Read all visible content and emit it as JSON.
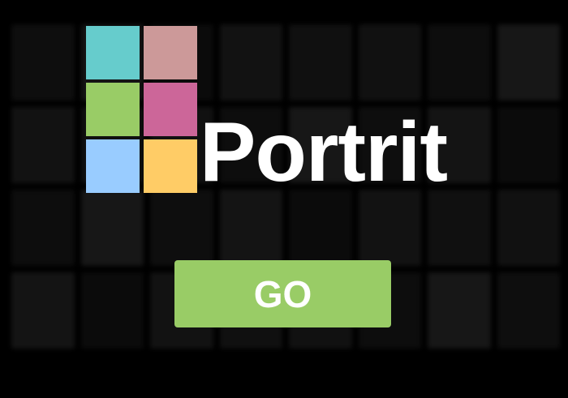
{
  "app": {
    "name": "Portrit"
  },
  "logo": {
    "wordmark": "Portrit",
    "squares": [
      {
        "name": "logo-square-teal",
        "color": "#66cccc"
      },
      {
        "name": "logo-square-rose",
        "color": "#cc9999"
      },
      {
        "name": "logo-square-green",
        "color": "#99cc66"
      },
      {
        "name": "logo-square-magenta",
        "color": "#cc6699"
      },
      {
        "name": "logo-square-lightblue",
        "color": "#99ccff"
      },
      {
        "name": "logo-square-yellow",
        "color": "#ffcc66"
      }
    ]
  },
  "go_button": {
    "label": "GO",
    "color": "#99cc66"
  },
  "background": {
    "color": "#000000",
    "tile_colors": [
      "#1a1a1a",
      "#222222",
      "#181818",
      "#262626",
      "#1e1e1e",
      "#2a2a2a",
      "#151515",
      "#202020"
    ]
  }
}
